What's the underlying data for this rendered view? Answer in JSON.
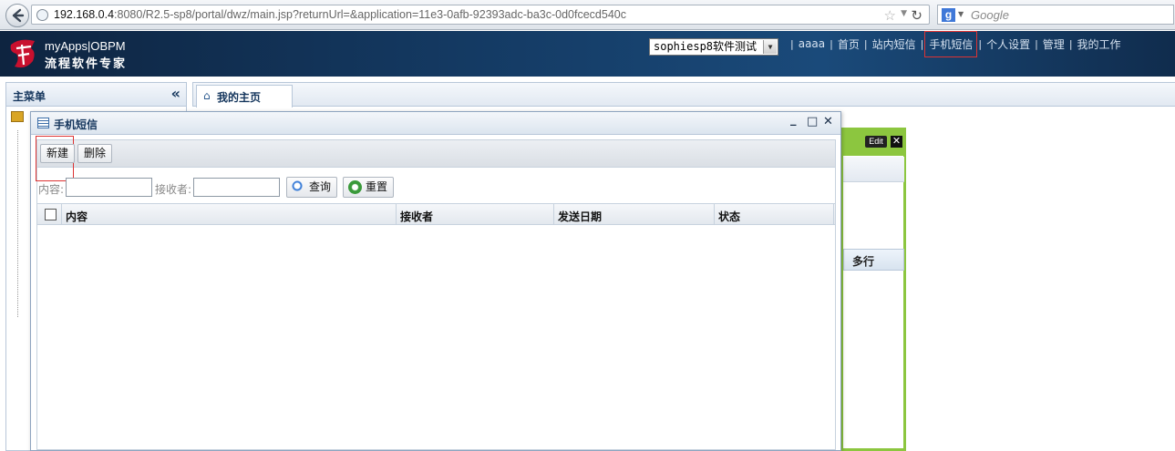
{
  "browser": {
    "url_host": "192.168.0.4",
    "url_rest": ":8080/R2.5-sp8/portal/dwz/main.jsp?returnUrl=&application=11e3-0afb-92393adc-ba3c-0d0fcecd540c",
    "search_placeholder": "Google",
    "search_engine_letter": "g"
  },
  "header": {
    "logo_line1": "myApps|OBPM",
    "logo_line2": "流程软件专家",
    "app_select_value": "sophiesp8软件测试",
    "nav": [
      {
        "label": "aaaa"
      },
      {
        "label": "首页"
      },
      {
        "label": "站内短信"
      },
      {
        "label": "手机短信"
      },
      {
        "label": "个人设置"
      },
      {
        "label": "管理"
      },
      {
        "label": "我的工作"
      }
    ]
  },
  "left_panel": {
    "title": "主菜单",
    "collapse_glyph": "«"
  },
  "tabs": {
    "home_label": "我的主页"
  },
  "portlet": {
    "edit_label": "Edit",
    "close_glyph": "✕",
    "column_label": "多行"
  },
  "dialog": {
    "title": "手机短信",
    "controls": {
      "minimize": "_",
      "maximize": "□",
      "close": "✕"
    },
    "toolbar": {
      "new_label": "新建",
      "delete_label": "删除"
    },
    "filter": {
      "content_label": "内容:",
      "receiver_label": "接收者:",
      "query_label": "查询",
      "reset_label": "重置"
    },
    "columns": [
      "内容",
      "接收者",
      "发送日期",
      "状态"
    ]
  },
  "colors": {
    "header_bg": "#143a63",
    "portlet_accent": "#8cc63f",
    "highlight_outline": "#dd3333"
  },
  "icons": [
    "back-arrow-icon",
    "globe-icon",
    "bookmark-star-icon",
    "reload-icon",
    "google-icon",
    "app-logo-icon",
    "folder-icon",
    "home-icon",
    "table-icon",
    "search-icon",
    "reset-icon",
    "close-icon",
    "maximize-icon",
    "minimize-icon"
  ]
}
